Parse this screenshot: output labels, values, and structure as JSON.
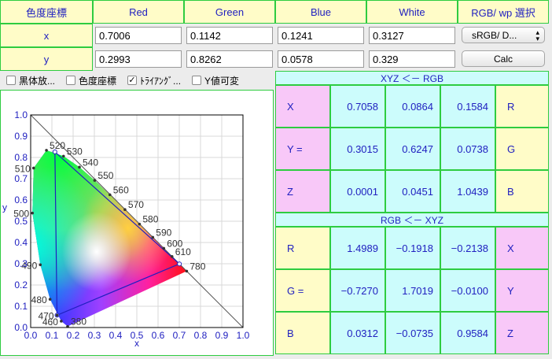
{
  "header": {
    "corner": "色度座標",
    "red": "Red",
    "green": "Green",
    "blue": "Blue",
    "white": "White",
    "rgb_wp": "RGB/ wp 選択"
  },
  "rows": [
    {
      "label": "x",
      "red": "0.7006",
      "green": "0.1142",
      "blue": "0.1241",
      "white": "0.3127"
    },
    {
      "label": "y",
      "red": "0.2993",
      "green": "0.8262",
      "blue": "0.0578",
      "white": "0.329"
    }
  ],
  "select_value": "sRGB/ D...",
  "calc_label": "Calc",
  "checkboxes": [
    {
      "label": "黒体放...",
      "checked": false
    },
    {
      "label": "色度座標",
      "checked": false
    },
    {
      "label": "ﾄﾗｲｱﾝｸﾞ...",
      "checked": true
    },
    {
      "label": "Y値可変",
      "checked": false
    }
  ],
  "matrix1": {
    "title": "XYZ ＜－ RGB",
    "rows": [
      {
        "left": "X",
        "v": [
          "0.7058",
          "0.0864",
          "0.1584"
        ],
        "right": "R"
      },
      {
        "left": "Y =",
        "v": [
          "0.3015",
          "0.6247",
          "0.0738"
        ],
        "right": "G"
      },
      {
        "left": "Z",
        "v": [
          "0.0001",
          "0.0451",
          "1.0439"
        ],
        "right": "B"
      }
    ]
  },
  "matrix2": {
    "title": "RGB ＜－ XYZ",
    "rows": [
      {
        "left": "R",
        "v": [
          "1.4989",
          "−0.1918",
          "−0.2138"
        ],
        "right": "X"
      },
      {
        "left": "G =",
        "v": [
          "−0.7270",
          "1.7019",
          "−0.0100"
        ],
        "right": "Y"
      },
      {
        "left": "B",
        "v": [
          "0.0312",
          "−0.0735",
          "0.9584"
        ],
        "right": "Z"
      }
    ]
  },
  "chart_data": {
    "type": "scatter",
    "xlabel": "x",
    "ylabel": "y",
    "xlim": [
      0,
      1
    ],
    "ylim": [
      0,
      1
    ],
    "ticks": [
      "0.0",
      "0.1",
      "0.2",
      "0.3",
      "0.4",
      "0.5",
      "0.6",
      "0.7",
      "0.8",
      "0.9",
      "1.0"
    ],
    "triangle": [
      [
        0.7006,
        0.2993
      ],
      [
        0.1142,
        0.8262
      ],
      [
        0.1241,
        0.0578
      ]
    ],
    "white_point": [
      0.3127,
      0.329
    ],
    "locus": [
      [
        0.1741,
        0.005
      ],
      [
        0.144,
        0.0297
      ],
      [
        0.0913,
        0.1327
      ],
      [
        0.0454,
        0.295
      ],
      [
        0.0082,
        0.5384
      ],
      [
        0.0139,
        0.7502
      ],
      [
        0.0743,
        0.8338
      ],
      [
        0.1547,
        0.8059
      ],
      [
        0.2296,
        0.7543
      ],
      [
        0.3016,
        0.6923
      ],
      [
        0.3731,
        0.6245
      ],
      [
        0.4441,
        0.5547
      ],
      [
        0.5125,
        0.4866
      ],
      [
        0.5752,
        0.4242
      ],
      [
        0.627,
        0.3725
      ],
      [
        0.6915,
        0.3083
      ],
      [
        0.7347,
        0.2653
      ]
    ],
    "wavelengths": [
      {
        "label": "520",
        "x": 0.0743,
        "y": 0.8338
      },
      {
        "label": "530",
        "x": 0.1547,
        "y": 0.8059
      },
      {
        "label": "540",
        "x": 0.2296,
        "y": 0.7543
      },
      {
        "label": "550",
        "x": 0.3016,
        "y": 0.6923
      },
      {
        "label": "560",
        "x": 0.3731,
        "y": 0.6245
      },
      {
        "label": "570",
        "x": 0.4441,
        "y": 0.5547
      },
      {
        "label": "580",
        "x": 0.5125,
        "y": 0.4866
      },
      {
        "label": "590",
        "x": 0.5752,
        "y": 0.4242
      },
      {
        "label": "600",
        "x": 0.627,
        "y": 0.3725
      },
      {
        "label": "610",
        "x": 0.6658,
        "y": 0.334
      },
      {
        "label": "780",
        "x": 0.7347,
        "y": 0.2653
      },
      {
        "label": "510",
        "x": 0.0139,
        "y": 0.7502
      },
      {
        "label": "500",
        "x": 0.0082,
        "y": 0.5384
      },
      {
        "label": "490",
        "x": 0.0454,
        "y": 0.295
      },
      {
        "label": "480",
        "x": 0.0913,
        "y": 0.1327
      },
      {
        "label": "470",
        "x": 0.1241,
        "y": 0.0578
      },
      {
        "label": "460",
        "x": 0.144,
        "y": 0.0297
      },
      {
        "label": "380",
        "x": 0.1741,
        "y": 0.005
      }
    ]
  }
}
